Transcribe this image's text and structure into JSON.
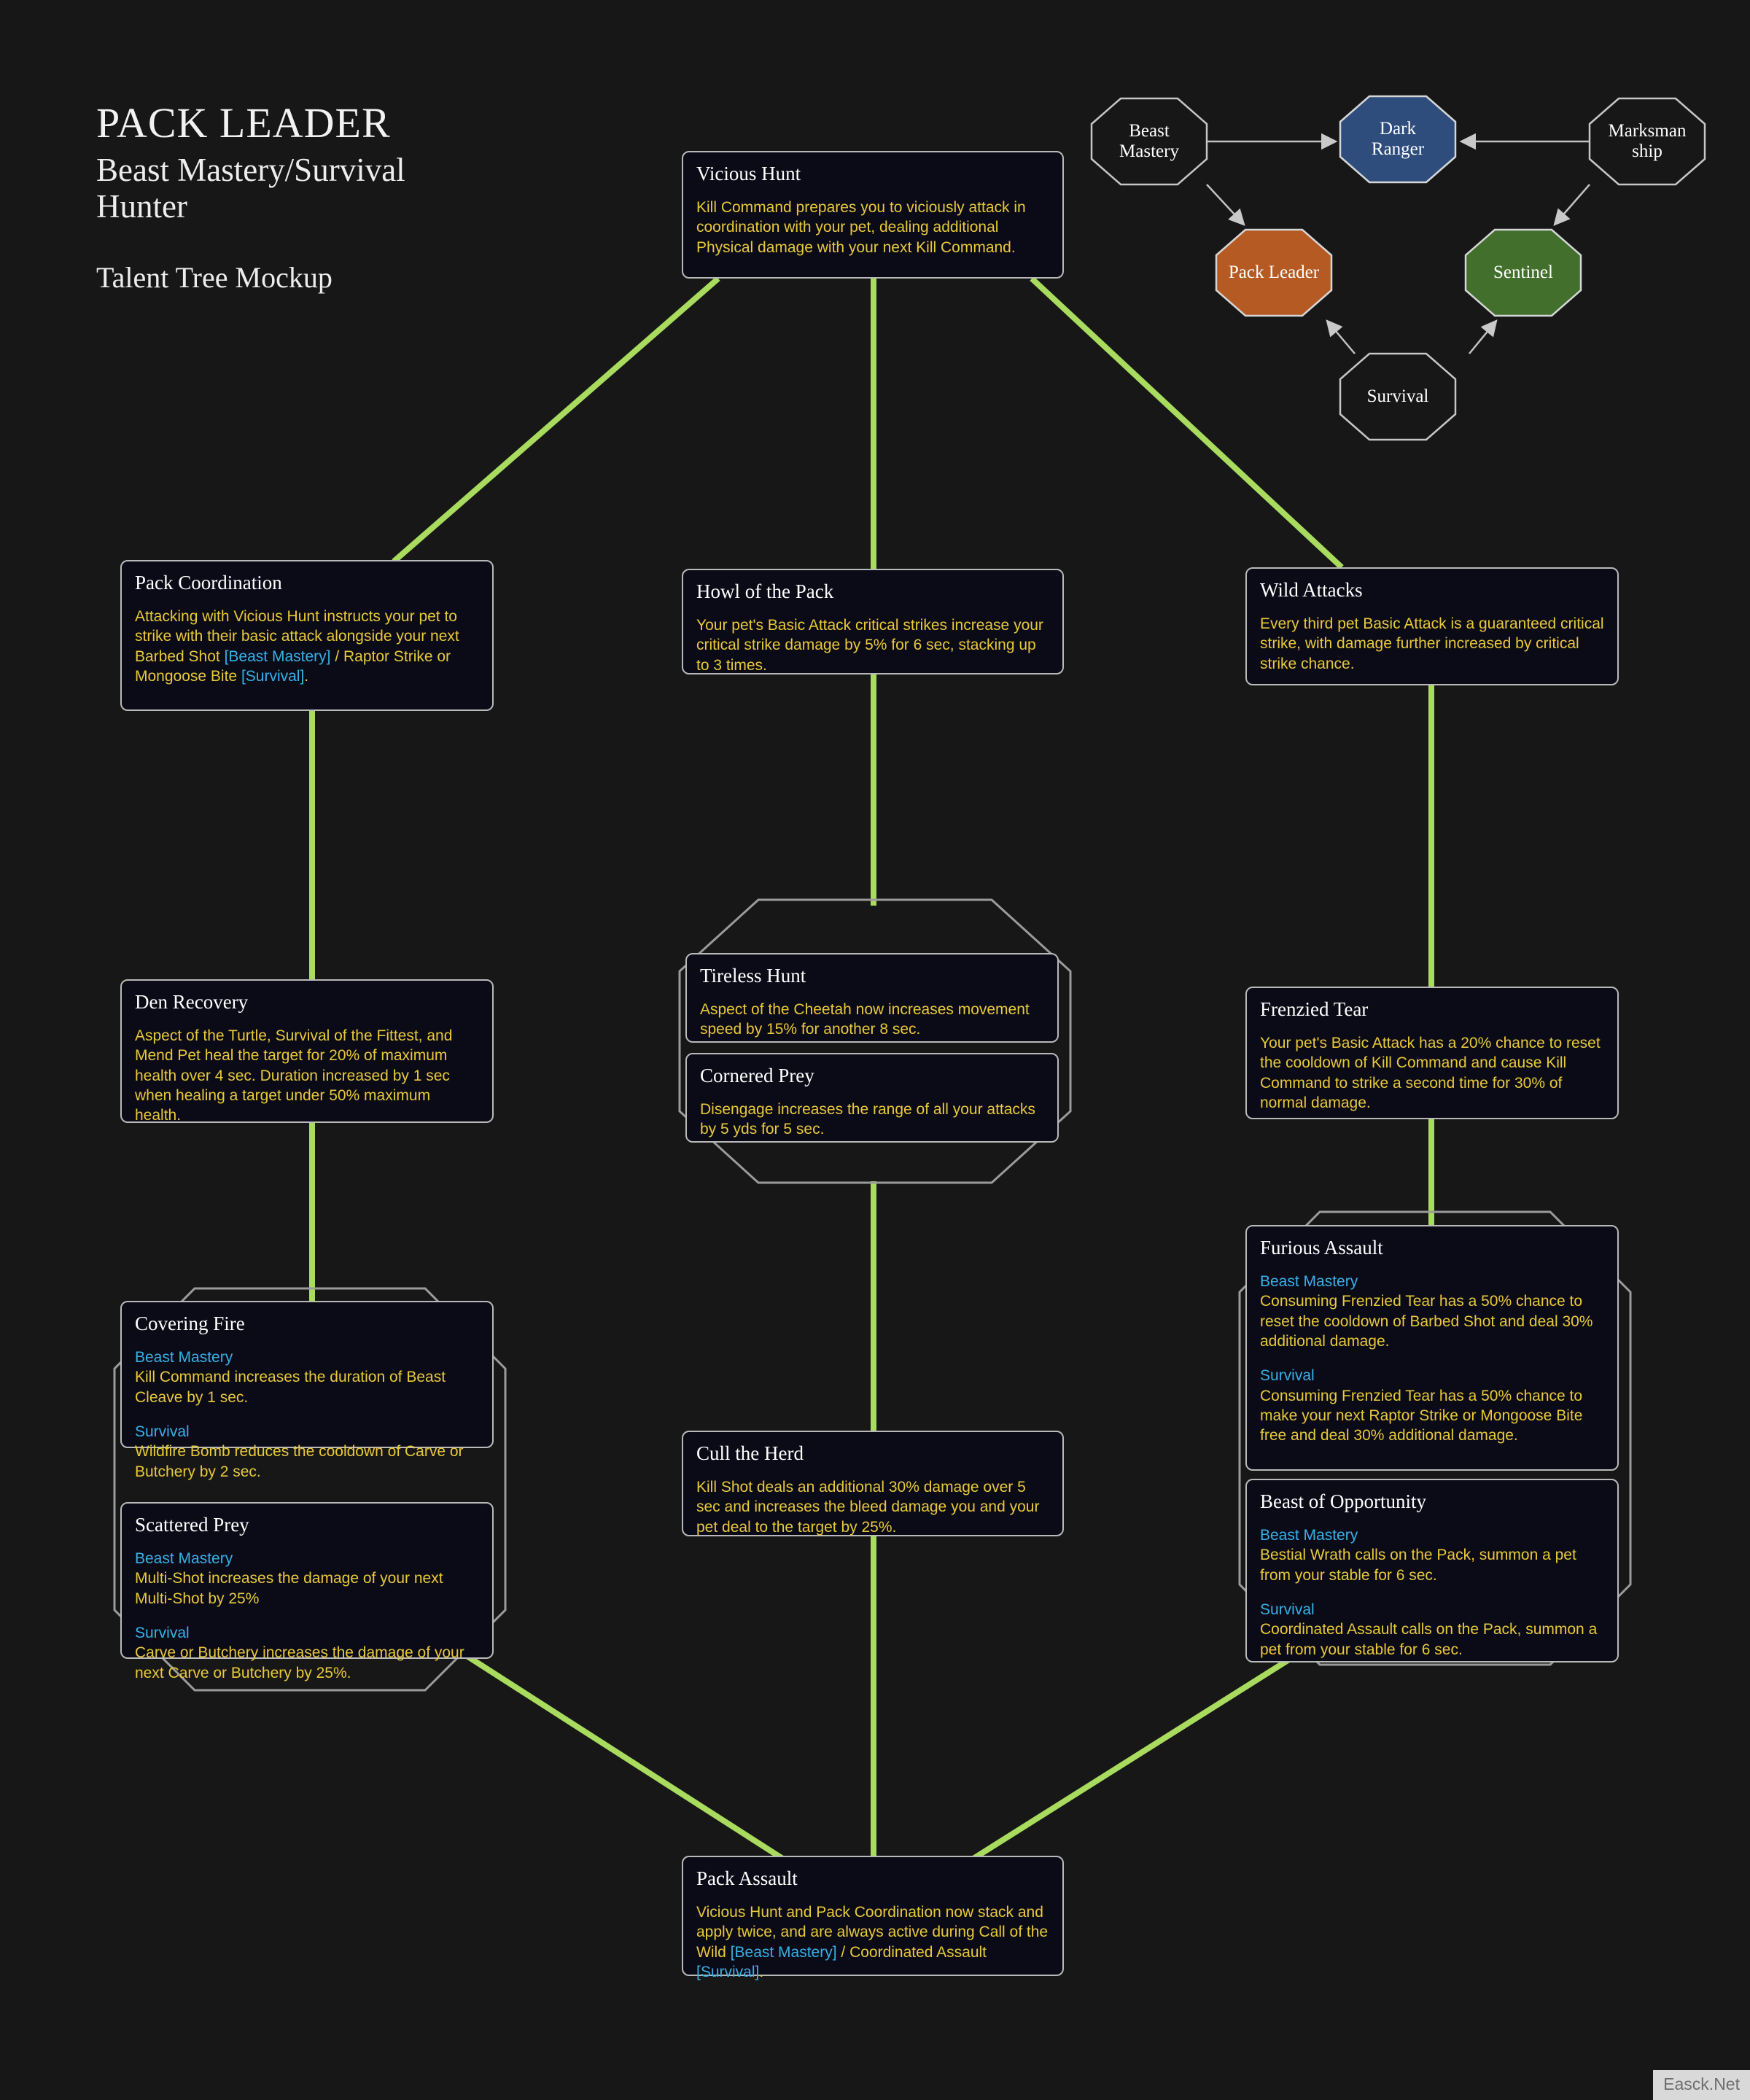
{
  "heading": {
    "title": "PACK LEADER",
    "subtitle_line1": "Beast Mastery/Survival",
    "subtitle_line2": "Hunter",
    "note": "Talent Tree Mockup"
  },
  "hero_tree": {
    "nodes": [
      {
        "id": "beast-mastery",
        "label": "Beast\nMastery",
        "fill": "none",
        "selected": false
      },
      {
        "id": "dark-ranger",
        "label": "Dark\nRanger",
        "fill": "#2E4D7D",
        "selected": true
      },
      {
        "id": "marksmanship",
        "label": "Marksman\nship",
        "fill": "none",
        "selected": false
      },
      {
        "id": "pack-leader",
        "label": "Pack Leader",
        "fill": "#B55A22",
        "selected": true
      },
      {
        "id": "sentinel",
        "label": "Sentinel",
        "fill": "#42702C",
        "selected": true
      },
      {
        "id": "survival",
        "label": "Survival",
        "fill": "none",
        "selected": false
      }
    ]
  },
  "colors": {
    "background": "#171717",
    "node_fill": "#0b0b18",
    "node_border": "#b9b9b9",
    "body_text": "#e8c93a",
    "spec_text": "#38b0e6",
    "title_text": "#ffffff",
    "connector": "#a8db5e"
  },
  "talents": {
    "vicious_hunt": {
      "title": "Vicious Hunt",
      "body": "Kill Command prepares you to viciously attack in coordination with your pet, dealing additional Physical damage with your next Kill Command."
    },
    "pack_coordination": {
      "title": "Pack Coordination",
      "body_pre": "Attacking with Vicious Hunt instructs your pet to strike with their basic attack alongside your next Barbed Shot ",
      "tag_bm": "[Beast Mastery]",
      "body_mid": " / Raptor Strike or Mongoose Bite ",
      "tag_sv": "[Survival]",
      "body_post": "."
    },
    "howl_of_the_pack": {
      "title": "Howl of the Pack",
      "body": "Your pet's Basic Attack critical strikes increase your critical strike damage by 5% for 6 sec, stacking up to 3 times."
    },
    "wild_attacks": {
      "title": "Wild Attacks",
      "body": "Every third pet Basic Attack is a guaranteed critical strike, with damage further increased by critical strike chance."
    },
    "den_recovery": {
      "title": "Den Recovery",
      "body": "Aspect of the Turtle, Survival of the Fittest, and Mend Pet heal the target for 20% of maximum health over 4 sec. Duration increased by 1 sec when healing a target under 50% maximum health."
    },
    "tireless_hunt": {
      "title": "Tireless Hunt",
      "body": "Aspect of the Cheetah now increases movement speed by 15% for another 8 sec."
    },
    "cornered_prey": {
      "title": "Cornered Prey",
      "body": "Disengage increases the range of all your attacks by 5 yds for 5 sec."
    },
    "frenzied_tear": {
      "title": "Frenzied Tear",
      "body": "Your pet's Basic Attack has a 20% chance to reset the cooldown of Kill Command and cause Kill Command to strike a second time for 30% of normal damage."
    },
    "covering_fire": {
      "title": "Covering Fire",
      "spec_bm": "Beast Mastery",
      "body_bm": "Kill Command increases the duration of Beast Cleave by 1 sec.",
      "spec_sv": "Survival",
      "body_sv": "Wildfire Bomb reduces the cooldown of Carve or Butchery by 2 sec."
    },
    "scattered_prey": {
      "title": "Scattered Prey",
      "spec_bm": "Beast Mastery",
      "body_bm": "Multi-Shot increases the damage of your next Multi-Shot by 25%",
      "spec_sv": "Survival",
      "body_sv": "Carve or Butchery increases the damage of your next Carve or Butchery by 25%."
    },
    "furious_assault": {
      "title": "Furious Assault",
      "spec_bm": "Beast Mastery",
      "body_bm": "Consuming Frenzied Tear has a 50% chance to reset the cooldown of Barbed Shot and deal 30% additional damage.",
      "spec_sv": "Survival",
      "body_sv": "Consuming Frenzied Tear has a 50% chance to make your next Raptor Strike or Mongoose Bite free and deal 30% additional damage."
    },
    "beast_of_opportunity": {
      "title": "Beast of Opportunity",
      "spec_bm": "Beast Mastery",
      "body_bm": "Bestial Wrath calls on the Pack, summon a pet from your stable for 6 sec.",
      "spec_sv": "Survival",
      "body_sv": "Coordinated Assault calls on the Pack, summon a pet from your stable for 6 sec."
    },
    "cull_the_herd": {
      "title": "Cull the Herd",
      "body": "Kill Shot deals an additional 30% damage over 5 sec and increases the bleed damage you and your pet deal to the target by 25%."
    },
    "pack_assault": {
      "title": "Pack Assault",
      "body_pre": "Vicious Hunt and Pack Coordination now stack and apply twice, and are always active during Call of the Wild ",
      "tag_bm": "[Beast Mastery]",
      "body_mid": " / Coordinated Assault ",
      "tag_sv": "[Survival]",
      "body_post": "."
    }
  },
  "watermark": {
    "text": "Easck.Net"
  }
}
